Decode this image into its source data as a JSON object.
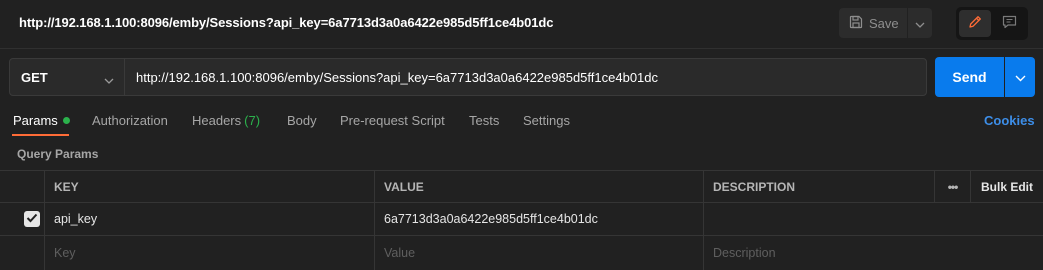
{
  "header": {
    "title": "http://192.168.1.100:8096/emby/Sessions?api_key=6a7713d3a0a6422e985d5ff1ce4b01dc",
    "save_label": "Save"
  },
  "request": {
    "method": "GET",
    "url": "http://192.168.1.100:8096/emby/Sessions?api_key=6a7713d3a0a6422e985d5ff1ce4b01dc",
    "send_label": "Send"
  },
  "tabs": {
    "params": "Params",
    "authorization": "Authorization",
    "headers": "Headers",
    "headers_count": "(7)",
    "body": "Body",
    "prerequest": "Pre-request Script",
    "tests": "Tests",
    "settings": "Settings",
    "cookies": "Cookies"
  },
  "query_params": {
    "section_label": "Query Params",
    "columns": {
      "key": "KEY",
      "value": "VALUE",
      "description": "DESCRIPTION",
      "more": "•••",
      "bulk_edit": "Bulk Edit"
    },
    "rows": [
      {
        "checked": true,
        "key": "api_key",
        "value": "6a7713d3a0a6422e985d5ff1ce4b01dc",
        "description": ""
      }
    ],
    "placeholders": {
      "key": "Key",
      "value": "Value",
      "description": "Description"
    }
  },
  "colors": {
    "accent_orange": "#ff6c37",
    "send_blue": "#097bed",
    "status_green": "#2bb24c",
    "link_blue": "#3d8ee8"
  },
  "icons": {
    "save": "save-icon",
    "edit": "pencil-icon",
    "comments": "comment-icon",
    "dropdown": "chevron-down-icon",
    "checkbox": "checkmark-icon"
  }
}
